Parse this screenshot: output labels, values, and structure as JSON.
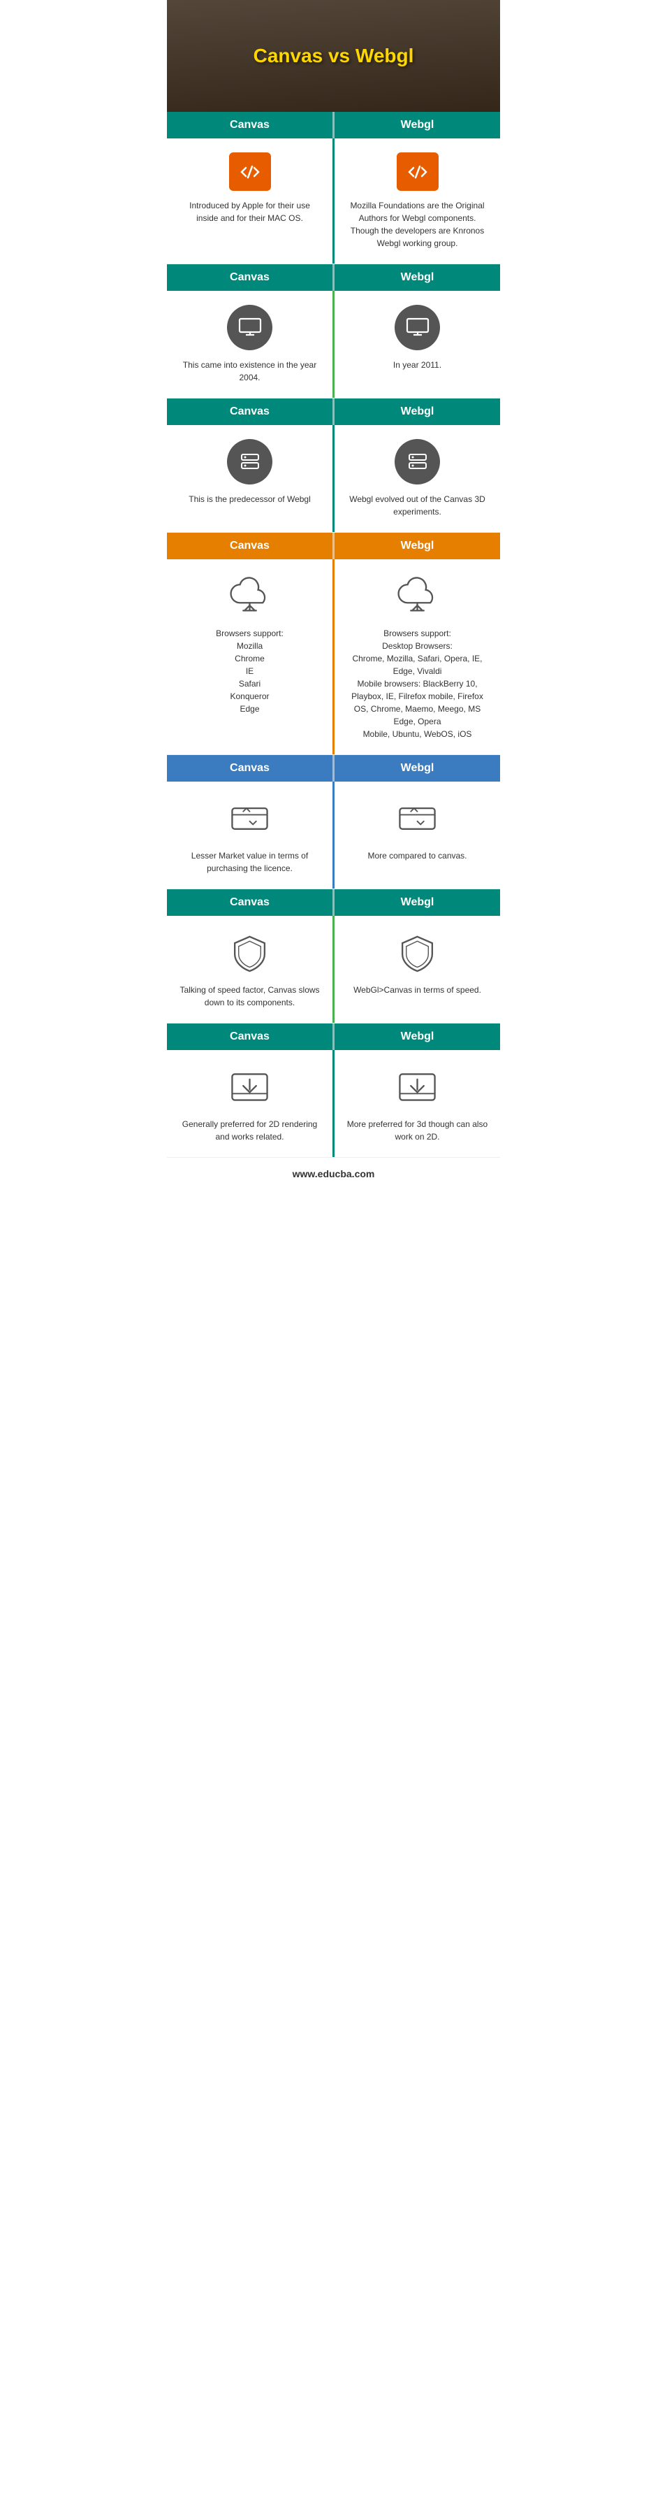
{
  "header": {
    "title": "Canvas vs Webgl"
  },
  "footer": {
    "url": "www.educba.com"
  },
  "sections": [
    {
      "id": "intro",
      "header_left": "Canvas",
      "header_right": "Webgl",
      "header_color": "teal",
      "divider_color": "teal-div",
      "icon_type": "code-box",
      "left_text": "Introduced by Apple for their use inside and for their MAC OS.",
      "right_text": "Mozilla Foundations are the Original Authors for Webgl components. Though the developers are Knronos Webgl working group."
    },
    {
      "id": "year",
      "header_left": "Canvas",
      "header_right": "Webgl",
      "header_color": "teal",
      "divider_color": "green-div",
      "icon_type": "monitor-circle",
      "left_text": "This came into existence in the year 2004.",
      "right_text": "In year 2011."
    },
    {
      "id": "predecessor",
      "header_left": "Canvas",
      "header_right": "Webgl",
      "header_color": "teal",
      "divider_color": "teal-div",
      "icon_type": "server-circle",
      "left_text": "This is the predecessor of Webgl",
      "right_text": "Webgl evolved out of the Canvas 3D experiments."
    },
    {
      "id": "browsers",
      "header_left": "Canvas",
      "header_right": "Webgl",
      "header_color": "orange",
      "divider_color": "orange-div",
      "icon_type": "cloud-outline",
      "left_text": "Browsers support:\nMozilla\nChrome\nIE\nSafari\nKonqueror\nEdge",
      "right_text": "Browsers support:\nDesktop Browsers:\nChrome, Mozilla, Safari, Opera, IE, Edge, Vivaldi\nMobile browsers: BlackBerry 10, Playbox, IE, Filrefox mobile, Firefox OS, Chrome, Maemo, Meego, MS Edge, Opera\nMobile, Ubuntu, WebOS, iOS"
    },
    {
      "id": "market",
      "header_left": "Canvas",
      "header_right": "Webgl",
      "header_color": "blue",
      "divider_color": "blue-div",
      "icon_type": "transfer-outline",
      "left_text": "Lesser Market value in terms of purchasing the licence.",
      "right_text": "More compared to canvas."
    },
    {
      "id": "speed",
      "header_left": "Canvas",
      "header_right": "Webgl",
      "header_color": "teal",
      "divider_color": "green-div",
      "icon_type": "shield-outline",
      "left_text": "Talking of speed factor, Canvas slows down to its components.",
      "right_text": "WebGl>Canvas in terms of speed."
    },
    {
      "id": "rendering",
      "header_left": "Canvas",
      "header_right": "Webgl",
      "header_color": "teal",
      "divider_color": "teal-div",
      "icon_type": "download-outline",
      "left_text": "Generally preferred for 2D rendering and works related.",
      "right_text": "More preferred for 3d though can also work on 2D."
    }
  ]
}
